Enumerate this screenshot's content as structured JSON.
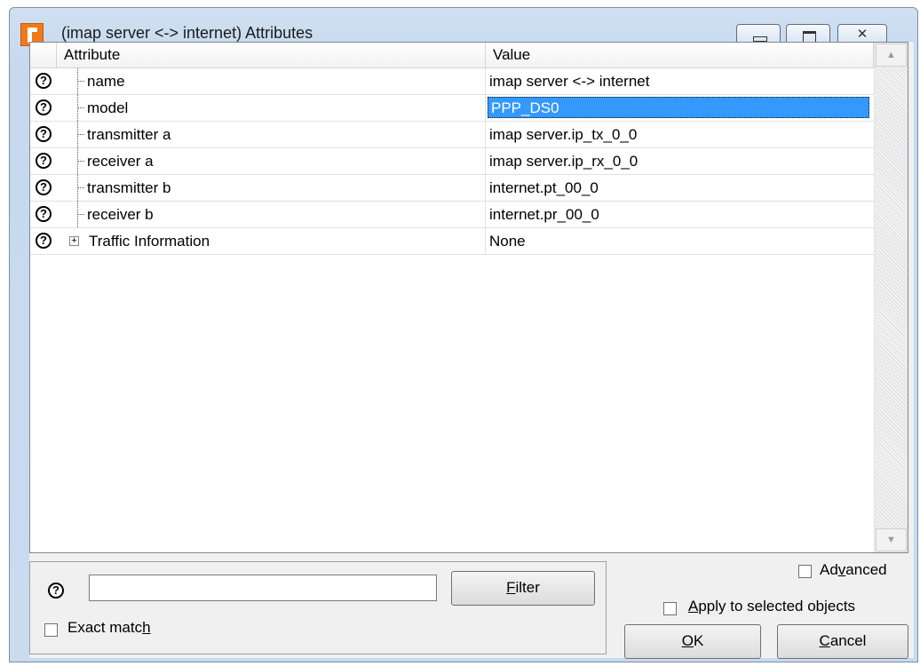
{
  "window": {
    "title": "(imap server <-> internet) Attributes",
    "controls": {
      "minimize": "minimize-icon",
      "maximize": "maximize-icon",
      "close": "close-icon",
      "close_glyph": "✕"
    }
  },
  "grid": {
    "columns": {
      "attribute": "Attribute",
      "value": "Value"
    },
    "rows": [
      {
        "attribute": "name",
        "value": "imap server <-> internet"
      },
      {
        "attribute": "model",
        "value": "PPP_DS0",
        "selected": true
      },
      {
        "attribute": "transmitter a",
        "value": "imap server.ip_tx_0_0"
      },
      {
        "attribute": "receiver a",
        "value": "imap server.ip_rx_0_0"
      },
      {
        "attribute": "transmitter b",
        "value": "internet.pt_00_0"
      },
      {
        "attribute": "receiver b",
        "value": "internet.pr_00_0"
      }
    ],
    "group_row": {
      "attribute": "Traffic Information",
      "value": "None",
      "expand_symbol": "+"
    },
    "help_glyph": "?",
    "scroll_up_glyph": "▲",
    "scroll_down_glyph": "▼"
  },
  "filter": {
    "input_value": "",
    "button_label": {
      "before": "",
      "underlined": "F",
      "after": "ilter"
    },
    "exact_match": {
      "before": "Exact matc",
      "underlined": "h",
      "after": "",
      "checked": false
    }
  },
  "options": {
    "advanced": {
      "before": "Ad",
      "underlined": "v",
      "after": "anced",
      "checked": false
    },
    "apply_to_selected": {
      "before": "",
      "underlined": "A",
      "after": "pply to selected objects",
      "checked": false
    }
  },
  "buttons": {
    "ok": {
      "before": "",
      "underlined": "O",
      "after": "K"
    },
    "cancel": {
      "before": "",
      "underlined": "C",
      "after": "ancel"
    }
  }
}
